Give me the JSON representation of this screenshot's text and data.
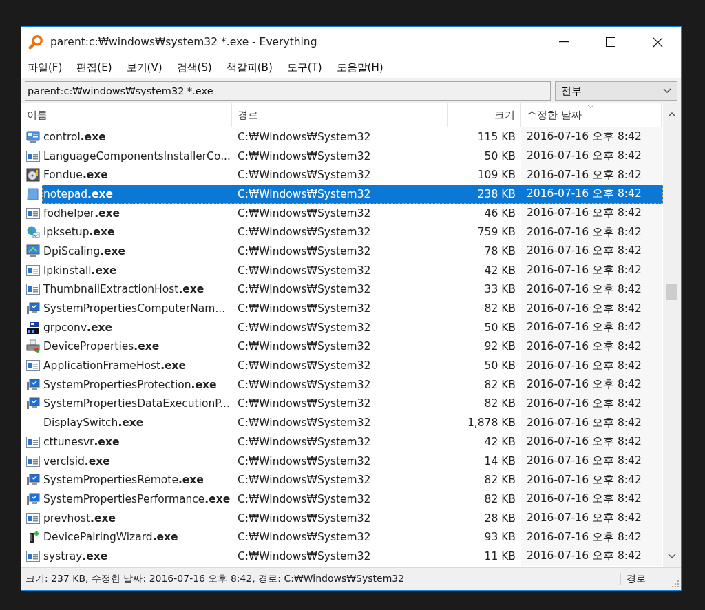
{
  "window": {
    "title": "parent:c:₩windows₩system32 *.exe - Everything"
  },
  "menu": [
    {
      "label": "파일(F)"
    },
    {
      "label": "편집(E)"
    },
    {
      "label": "보기(V)"
    },
    {
      "label": "검색(S)"
    },
    {
      "label": "책갈피(B)"
    },
    {
      "label": "도구(T)"
    },
    {
      "label": "도움말(H)"
    }
  ],
  "search": {
    "value": "parent:c:₩windows₩system32 *.exe"
  },
  "filter": {
    "value": "전부"
  },
  "table": {
    "columns": [
      {
        "label": "이름",
        "sorted": false
      },
      {
        "label": "경로",
        "sorted": false
      },
      {
        "label": "크기",
        "sorted": false
      },
      {
        "label": "수정한 날짜",
        "sorted": true
      }
    ],
    "rows": [
      {
        "kind": "control-panel",
        "name": "control**.exe**",
        "path": "C:₩Windows₩System32",
        "size": "115 KB",
        "modified": "2016-07-16 오후 8:42",
        "selected": false
      },
      {
        "kind": "window",
        "name": "LanguageComponentsInstallerCo...",
        "path": "C:₩Windows₩System32",
        "size": "50 KB",
        "modified": "2016-07-16 오후 8:42",
        "selected": false
      },
      {
        "kind": "disc",
        "name": "Fondue**.exe**",
        "path": "C:₩Windows₩System32",
        "size": "109 KB",
        "modified": "2016-07-16 오후 8:42",
        "selected": false
      },
      {
        "kind": "page",
        "name": "notepad**.exe**",
        "path": "C:₩Windows₩System32",
        "size": "238 KB",
        "modified": "2016-07-16 오후 8:42",
        "selected": true
      },
      {
        "kind": "window",
        "name": "fodhelper**.exe**",
        "path": "C:₩Windows₩System32",
        "size": "46 KB",
        "modified": "2016-07-16 오후 8:42",
        "selected": false
      },
      {
        "kind": "globe",
        "name": "lpksetup**.exe**",
        "path": "C:₩Windows₩System32",
        "size": "759 KB",
        "modified": "2016-07-16 오후 8:42",
        "selected": false
      },
      {
        "kind": "monitor",
        "name": "DpiScaling**.exe**",
        "path": "C:₩Windows₩System32",
        "size": "78 KB",
        "modified": "2016-07-16 오후 8:42",
        "selected": false
      },
      {
        "kind": "window",
        "name": "lpkinstall**.exe**",
        "path": "C:₩Windows₩System32",
        "size": "42 KB",
        "modified": "2016-07-16 오후 8:42",
        "selected": false
      },
      {
        "kind": "window",
        "name": "ThumbnailExtractionHost**.exe**",
        "path": "C:₩Windows₩System32",
        "size": "33 KB",
        "modified": "2016-07-16 오후 8:42",
        "selected": false
      },
      {
        "kind": "computer",
        "name": "SystemPropertiesComputerNam...",
        "path": "C:₩Windows₩System32",
        "size": "82 KB",
        "modified": "2016-07-16 오후 8:42",
        "selected": false
      },
      {
        "kind": "blocks",
        "name": "grpconv**.exe**",
        "path": "C:₩Windows₩System32",
        "size": "50 KB",
        "modified": "2016-07-16 오후 8:42",
        "selected": false
      },
      {
        "kind": "printer",
        "name": "DeviceProperties**.exe**",
        "path": "C:₩Windows₩System32",
        "size": "92 KB",
        "modified": "2016-07-16 오후 8:42",
        "selected": false
      },
      {
        "kind": "window",
        "name": "ApplicationFrameHost**.exe**",
        "path": "C:₩Windows₩System32",
        "size": "50 KB",
        "modified": "2016-07-16 오후 8:42",
        "selected": false
      },
      {
        "kind": "computer",
        "name": "SystemPropertiesProtection**.exe**",
        "path": "C:₩Windows₩System32",
        "size": "82 KB",
        "modified": "2016-07-16 오후 8:42",
        "selected": false
      },
      {
        "kind": "computer",
        "name": "SystemPropertiesDataExecutionP...",
        "path": "C:₩Windows₩System32",
        "size": "82 KB",
        "modified": "2016-07-16 오후 8:42",
        "selected": false
      },
      {
        "kind": "none",
        "name": "DisplaySwitch**.exe**",
        "path": "C:₩Windows₩System32",
        "size": "1,878 KB",
        "modified": "2016-07-16 오후 8:42",
        "selected": false
      },
      {
        "kind": "window",
        "name": "cttunesvr**.exe**",
        "path": "C:₩Windows₩System32",
        "size": "42 KB",
        "modified": "2016-07-16 오후 8:42",
        "selected": false
      },
      {
        "kind": "window",
        "name": "verclsid**.exe**",
        "path": "C:₩Windows₩System32",
        "size": "14 KB",
        "modified": "2016-07-16 오후 8:42",
        "selected": false
      },
      {
        "kind": "computer",
        "name": "SystemPropertiesRemote**.exe**",
        "path": "C:₩Windows₩System32",
        "size": "82 KB",
        "modified": "2016-07-16 오후 8:42",
        "selected": false
      },
      {
        "kind": "computer",
        "name": "SystemPropertiesPerformance**.exe**",
        "path": "C:₩Windows₩System32",
        "size": "82 KB",
        "modified": "2016-07-16 오후 8:42",
        "selected": false
      },
      {
        "kind": "window",
        "name": "prevhost**.exe**",
        "path": "C:₩Windows₩System32",
        "size": "28 KB",
        "modified": "2016-07-16 오후 8:42",
        "selected": false
      },
      {
        "kind": "tower",
        "name": "DevicePairingWizard**.exe**",
        "path": "C:₩Windows₩System32",
        "size": "93 KB",
        "modified": "2016-07-16 오후 8:42",
        "selected": false
      },
      {
        "kind": "window",
        "name": "systray**.exe**",
        "path": "C:₩Windows₩System32",
        "size": "11 KB",
        "modified": "2016-07-16 오후 8:42",
        "selected": false
      }
    ]
  },
  "status_bar": {
    "text": "크기: 237 KB, 수정한 날짜: 2016-07-16 오후 8:42, 경로: C:₩Windows₩System32",
    "right": "경로"
  }
}
